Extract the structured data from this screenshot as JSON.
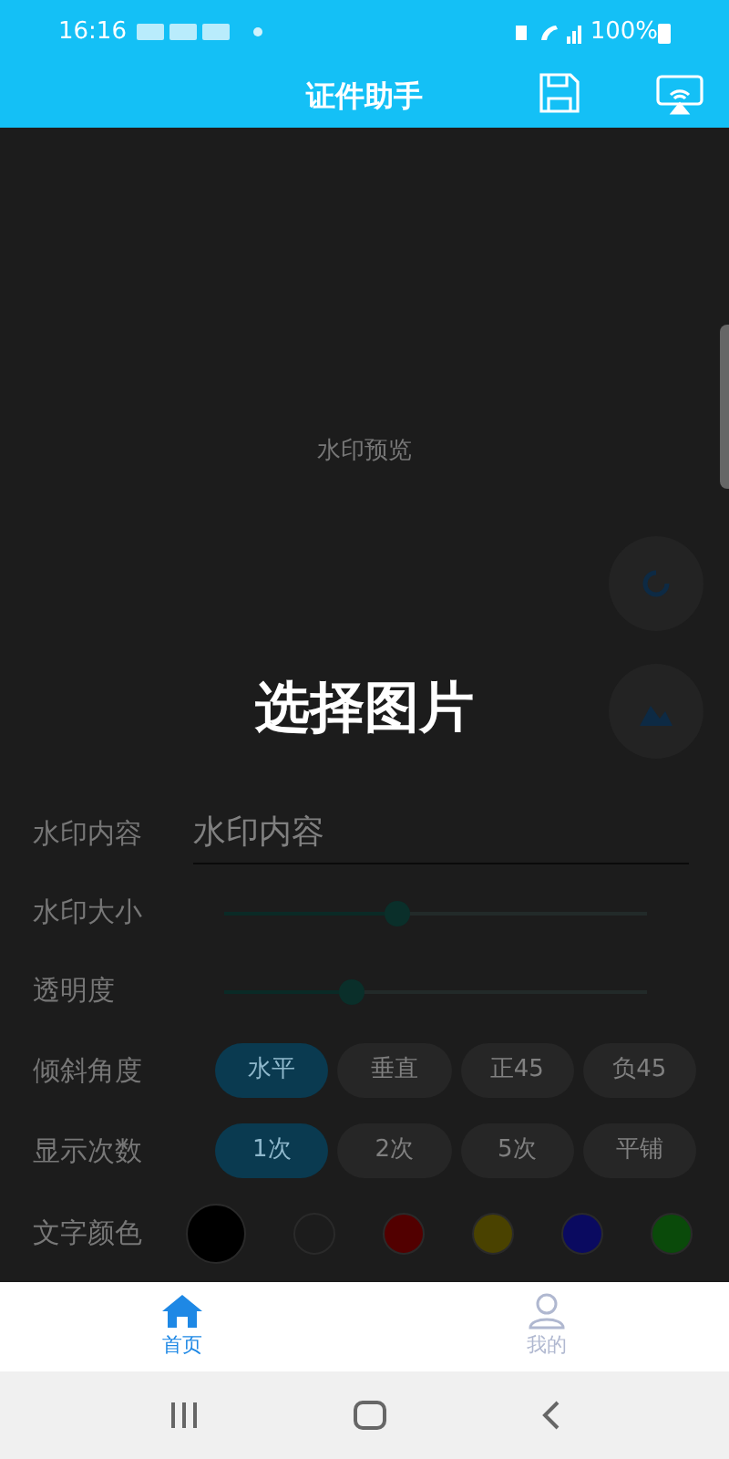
{
  "status_bar": {
    "time": "16:16",
    "battery": "100%"
  },
  "app_bar": {
    "title": "证件助手"
  },
  "preview": {
    "text": "水印预览"
  },
  "overlay": {
    "text": "选择图片"
  },
  "form": {
    "watermark_text": {
      "label": "水印内容",
      "placeholder": "水印内容"
    },
    "size": {
      "label": "水印大小",
      "level": 0.41
    },
    "opacity": {
      "label": "透明度",
      "level": 0.3
    },
    "angle": {
      "label": "倾斜角度",
      "options": [
        {
          "label": "水平",
          "selected": true
        },
        {
          "label": "垂直",
          "selected": false
        },
        {
          "label": "正45",
          "selected": false
        },
        {
          "label": "负45",
          "selected": false
        }
      ]
    },
    "count": {
      "label": "显示次数",
      "options": [
        {
          "label": "1次",
          "selected": true
        },
        {
          "label": "2次",
          "selected": false
        },
        {
          "label": "5次",
          "selected": false
        },
        {
          "label": "平铺",
          "selected": false
        }
      ]
    },
    "text_color": {
      "label": "文字颜色",
      "swatches": [
        {
          "color": "#000000",
          "selected": true
        },
        {
          "color": "#1c1c1c",
          "selected": false
        },
        {
          "color": "#520000",
          "selected": false
        },
        {
          "color": "#4a4200",
          "selected": false
        },
        {
          "color": "#0a0a60",
          "selected": false
        },
        {
          "color": "#0a4a0a",
          "selected": false
        }
      ]
    }
  },
  "bottom_nav": {
    "items": [
      {
        "kind": "home",
        "label": "首页",
        "selected": true
      },
      {
        "kind": "profile",
        "label": "我的",
        "selected": false
      }
    ]
  }
}
